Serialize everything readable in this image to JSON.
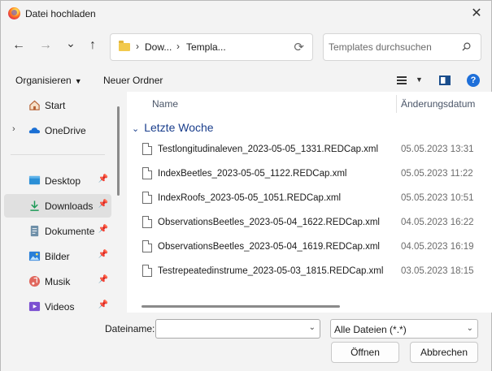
{
  "window": {
    "title": "Datei hochladen",
    "close_glyph": "✕",
    "logo_icon": "firefox-logo-icon"
  },
  "navigation": {
    "back_glyph": "←",
    "forward_glyph": "→",
    "recent_glyph": "⌄",
    "up_glyph": "↑",
    "breadcrumb": [
      "Dow...",
      "Templa..."
    ],
    "breadcrumb_separator": "›",
    "refresh_glyph": "⟳",
    "search_placeholder": "Templates durchsuchen"
  },
  "toolbar": {
    "organize_label": "Organisieren",
    "new_folder_label": "Neuer Ordner",
    "dropdown_glyph": "▼",
    "help_glyph": "?"
  },
  "sidebar": {
    "items": [
      {
        "label": "Start",
        "icon": "home-icon",
        "pinned": false
      },
      {
        "label": "OneDrive",
        "icon": "cloud-icon",
        "pinned": false,
        "expandable": true
      },
      {
        "label": "Desktop",
        "icon": "desktop-icon",
        "pinned": true
      },
      {
        "label": "Downloads",
        "icon": "download-icon",
        "pinned": true,
        "selected": true
      },
      {
        "label": "Dokumente",
        "icon": "document-icon",
        "pinned": true
      },
      {
        "label": "Bilder",
        "icon": "pictures-icon",
        "pinned": true
      },
      {
        "label": "Musik",
        "icon": "music-icon",
        "pinned": true
      },
      {
        "label": "Videos",
        "icon": "videos-icon",
        "pinned": true
      }
    ],
    "pin_glyph": "📌",
    "expander_glyph": "›"
  },
  "filelist": {
    "columns": {
      "name": "Name",
      "date": "Änderungsdatum"
    },
    "group_label": "Letzte Woche",
    "group_chevron": "⌄",
    "files": [
      {
        "name": "Testlongitudinaleven_2023-05-05_1331.REDCap.xml",
        "date": "05.05.2023 13:31"
      },
      {
        "name": "IndexBeetles_2023-05-05_1122.REDCap.xml",
        "date": "05.05.2023 11:22"
      },
      {
        "name": "IndexRoofs_2023-05-05_1051.REDCap.xml",
        "date": "05.05.2023 10:51"
      },
      {
        "name": "ObservationsBeetles_2023-05-04_1622.REDCap.xml",
        "date": "04.05.2023 16:22"
      },
      {
        "name": "ObservationsBeetles_2023-05-04_1619.REDCap.xml",
        "date": "04.05.2023 16:19"
      },
      {
        "name": "Testrepeatedinstrume_2023-05-03_1815.REDCap.xml",
        "date": "03.05.2023 18:15"
      }
    ]
  },
  "footer": {
    "filename_label": "Dateiname:",
    "filename_value": "",
    "filter_value": "Alle Dateien (*.*)",
    "dropdown_glyph": "⌄",
    "open_label": "Öffnen",
    "cancel_label": "Abbrechen"
  },
  "colors": {
    "accent": "#1e6fd9",
    "group_header": "#1a3e8c",
    "selected_bg": "#e0e0e0"
  }
}
